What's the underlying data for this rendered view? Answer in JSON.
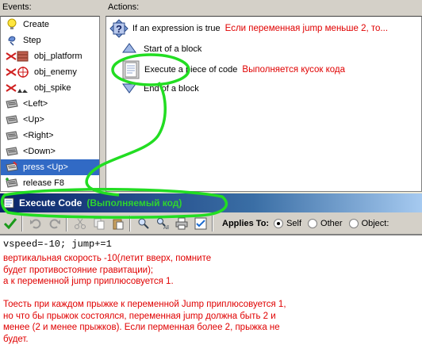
{
  "events_panel": {
    "label": "Events:",
    "items": [
      {
        "label": "Create",
        "icon": "bulb-icon"
      },
      {
        "label": "Step",
        "icon": "step-icon"
      },
      {
        "label": "obj_platform",
        "icon": "collision-platform-icon"
      },
      {
        "label": "obj_enemy",
        "icon": "collision-enemy-icon"
      },
      {
        "label": "obj_spike",
        "icon": "collision-spike-icon"
      },
      {
        "label": "<Left>",
        "icon": "keyboard-icon"
      },
      {
        "label": "<Up>",
        "icon": "keyboard-icon"
      },
      {
        "label": "<Right>",
        "icon": "keyboard-icon"
      },
      {
        "label": "<Down>",
        "icon": "keyboard-icon"
      },
      {
        "label": "press <Up>",
        "icon": "keyboard-press-icon"
      },
      {
        "label": "release F8",
        "icon": "keyboard-release-icon"
      }
    ],
    "selected_index": 9
  },
  "actions_panel": {
    "label": "Actions:",
    "if_expression": {
      "label": "If an expression is true",
      "note": "Если переменная jump меньше 2, то..."
    },
    "start_block": "Start of a block",
    "execute_code": {
      "label": "Execute a piece of code",
      "note": "Выполняется кусок кода"
    },
    "end_block": "End of a block"
  },
  "code_window": {
    "title": "Execute Code",
    "title_note": "(Выполняемый код)",
    "applies_to_label": "Applies To:",
    "applies_options": [
      "Self",
      "Other",
      "Object:"
    ],
    "applies_selected": "Self",
    "code": "vspeed=-10; jump+=1",
    "explanation_lines": [
      "вертикальная скорость -10(летит вверх, помните",
      "будет противостояние гравитации);",
      "а к переменной jump приплюсовуется 1.",
      "",
      "Тоесть при каждом прыжке к переменной Jump приплюсовуется 1,",
      "но что бы прыжок состоялся, переменная jump должна быть 2 и",
      "менее (2 и менее прыжков). Если перменная более 2, прыжка не",
      "будет."
    ]
  },
  "colors": {
    "annotation_green": "#22dd22",
    "note_red": "#e00000",
    "selection_blue": "#316ac5"
  }
}
